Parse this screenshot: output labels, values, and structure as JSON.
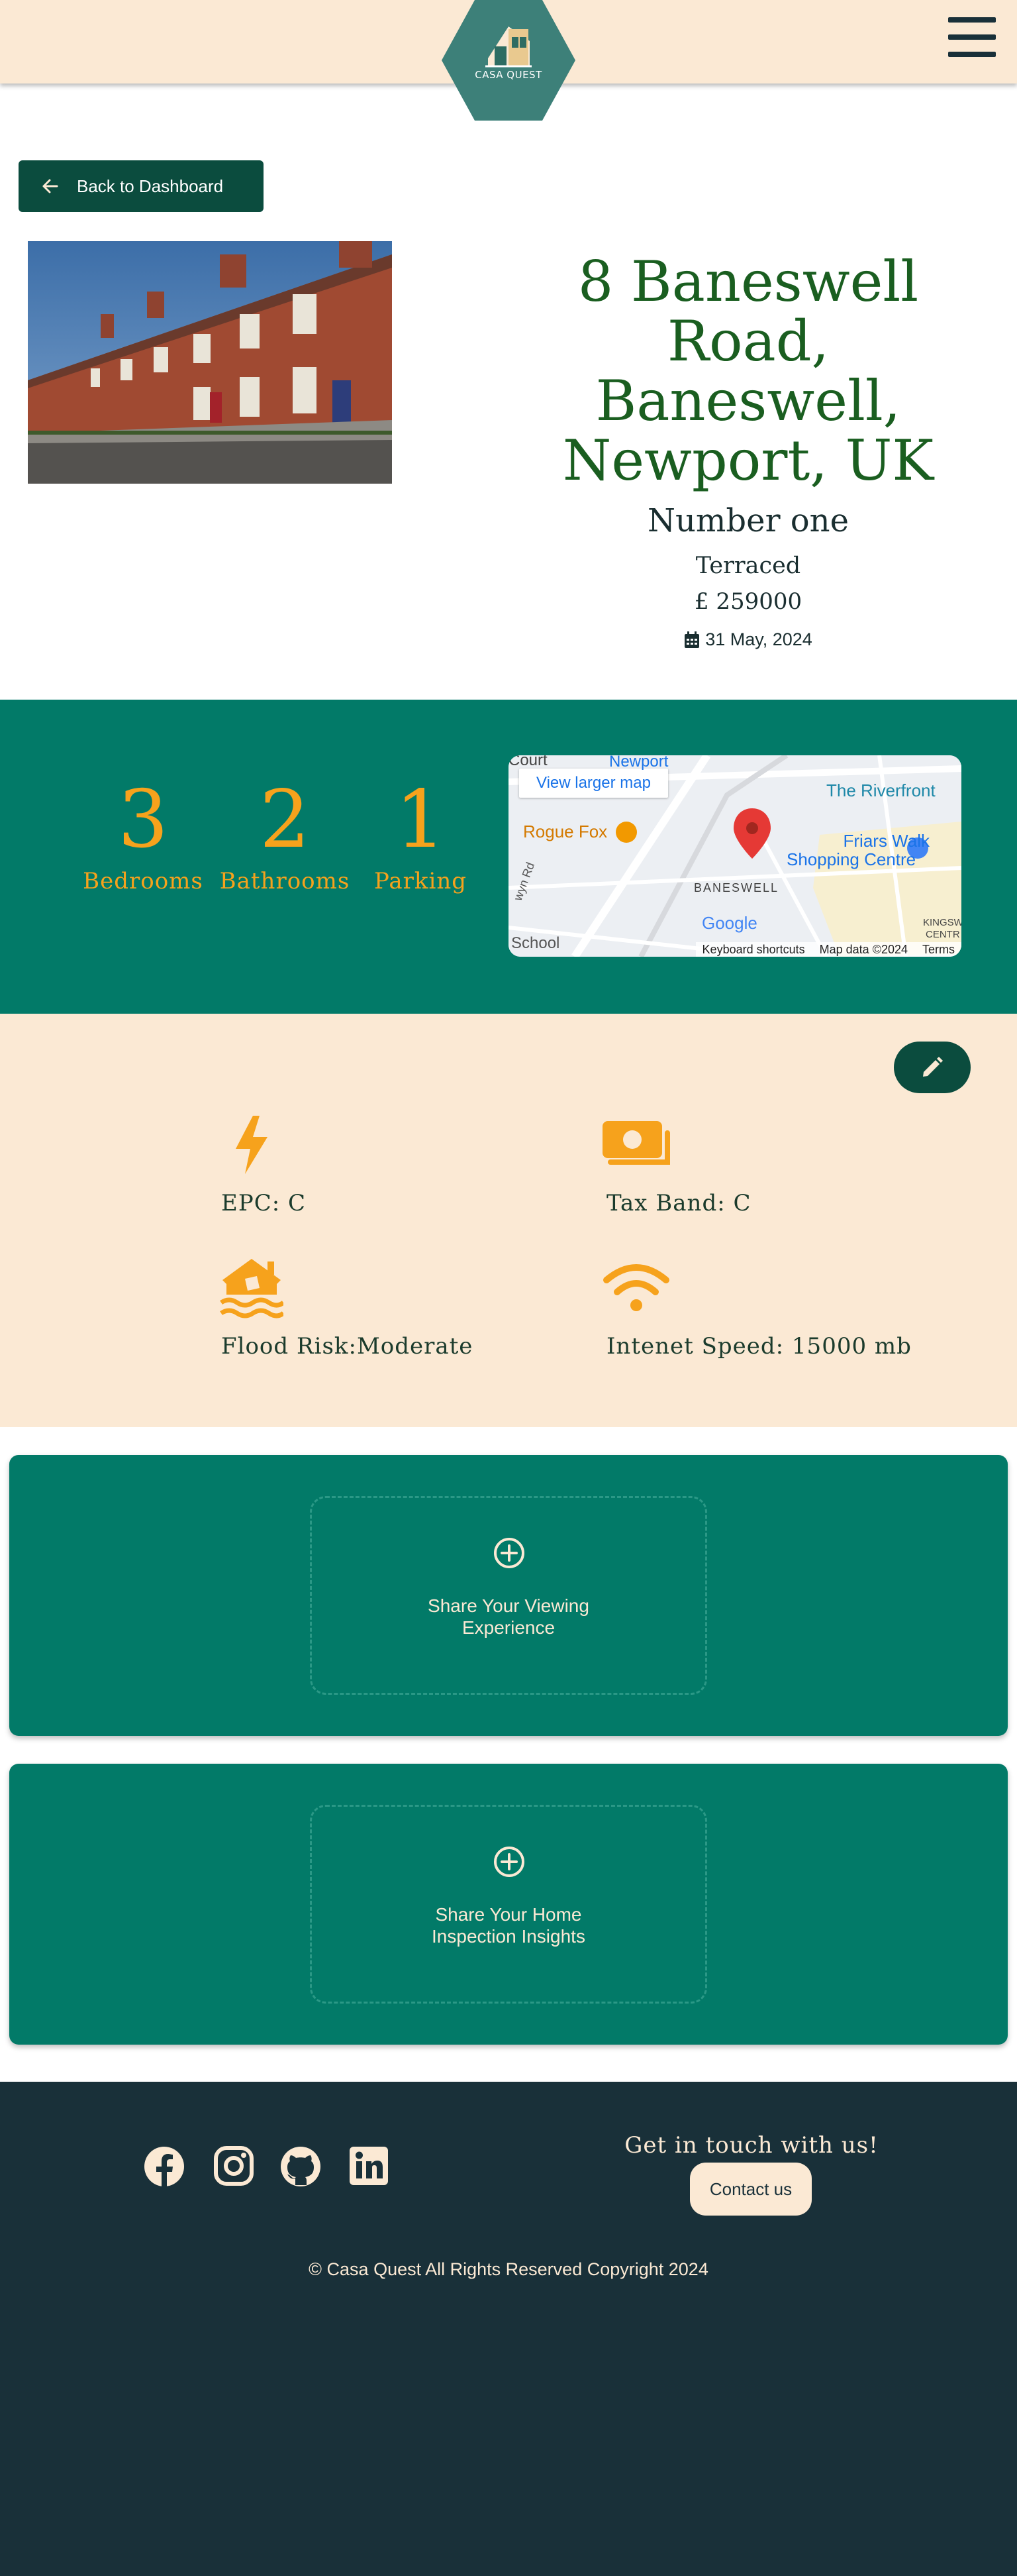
{
  "header": {
    "logo_text": "CASA QUEST",
    "menu_icon": "hamburger-menu-icon"
  },
  "colors": {
    "header_bg": "#fbe9d4",
    "primary_green": "#027a68",
    "dark_green": "#0b4c3e",
    "accent_orange": "#f6a21c",
    "footer_bg": "#193039",
    "address_green": "#1a5e20"
  },
  "back_button": {
    "label": "Back to Dashboard",
    "icon": "arrow-left-icon"
  },
  "property": {
    "address": "8 Baneswell Road, Baneswell, Newport, UK",
    "name": "Number one",
    "type": "Terraced",
    "price": "£ 259000",
    "date": "31 May, 2024",
    "date_icon": "calendar-icon",
    "photo": "terraced-houses-photo"
  },
  "stats": [
    {
      "value": "3",
      "label": "Bedrooms"
    },
    {
      "value": "2",
      "label": "Bathrooms"
    },
    {
      "value": "1",
      "label": "Parking"
    }
  ],
  "map": {
    "view_larger": "View larger map",
    "labels": {
      "court": "Court",
      "newport": "Newport",
      "riverfront": "The Riverfront",
      "rogue_fox": "Rogue Fox",
      "friars_walk_1": "Friars Walk",
      "friars_walk_2": "Shopping Centre",
      "baneswell": "BANESWELL",
      "school": "School",
      "google": "Google",
      "road": "wyn Rd",
      "kingsway_1": "KINGSW",
      "kingsway_2": "CENTR"
    },
    "footer": {
      "shortcuts": "Keyboard shortcuts",
      "map_data": "Map data ©2024",
      "terms": "Terms"
    }
  },
  "details": {
    "edit_icon": "pencil-icon",
    "items": [
      {
        "label": "EPC: C",
        "icon": "lightning-bolt-icon"
      },
      {
        "label": "Tax Band: C",
        "icon": "money-bills-icon"
      },
      {
        "label": "Flood Risk:Moderate",
        "icon": "house-flood-icon"
      },
      {
        "label": "Intenet Speed: 15000 mb",
        "icon": "wifi-icon"
      }
    ]
  },
  "share_cards": [
    {
      "line1": "Share Your Viewing",
      "line2": "Experience",
      "icon": "plus-circle-icon"
    },
    {
      "line1": "Share Your Home",
      "line2": "Inspection Insights",
      "icon": "plus-circle-icon"
    }
  ],
  "footer": {
    "social_icons": [
      "facebook-icon",
      "instagram-icon",
      "github-icon",
      "linkedin-icon"
    ],
    "get_in_touch": "Get in touch with us!",
    "contact_button": "Contact us",
    "copyright": "© Casa Quest All Rights Reserved Copyright 2024"
  }
}
